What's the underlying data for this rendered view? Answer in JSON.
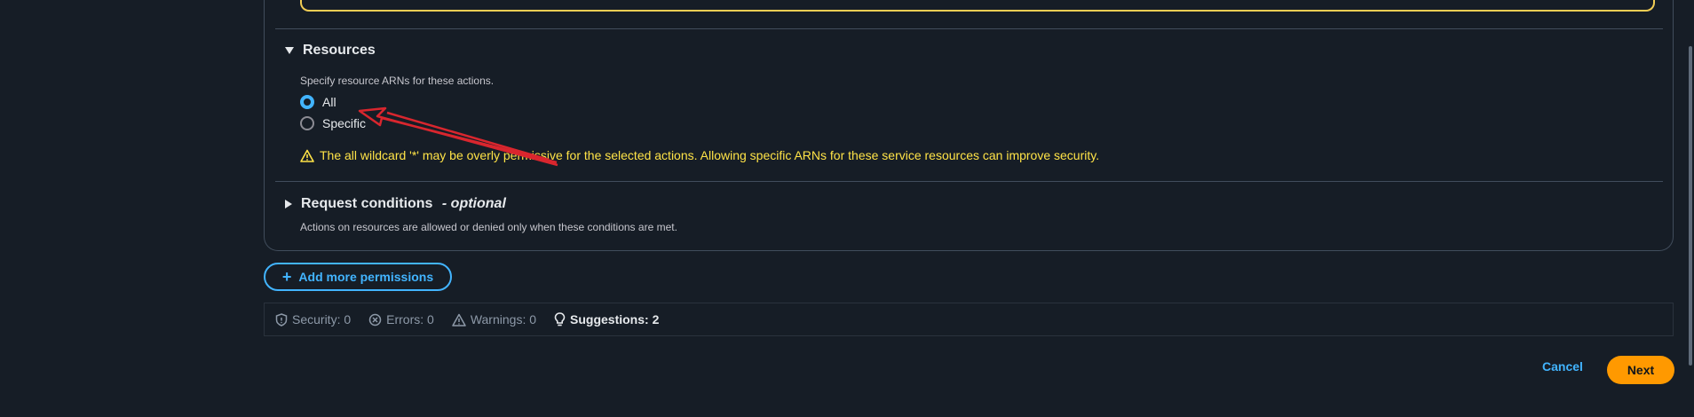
{
  "resources": {
    "title": "Resources",
    "description": "Specify resource ARNs for these actions.",
    "options": [
      {
        "label": "All",
        "selected": true
      },
      {
        "label": "Specific",
        "selected": false
      }
    ],
    "warning": "The all wildcard '*' may be overly permissive for the selected actions. Allowing specific ARNs for these service resources can improve security."
  },
  "request_conditions": {
    "title": "Request conditions",
    "optional": "- optional",
    "description": "Actions on resources are allowed or denied only when these conditions are met."
  },
  "add_more_label": "Add more permissions",
  "status": {
    "security": "Security: 0",
    "errors": "Errors: 0",
    "warnings": "Warnings: 0",
    "suggestions": "Suggestions: 2"
  },
  "footer": {
    "cancel": "Cancel",
    "next": "Next"
  },
  "colors": {
    "background": "#161d26",
    "accent": "#42b4ff",
    "warning": "#ffe347",
    "primary_button": "#ff9900",
    "annotation_arrow": "#d9262e"
  },
  "icons": {
    "resources_toggle": "caret-down-icon",
    "conditions_toggle": "caret-right-icon",
    "warning": "warning-triangle-icon",
    "add": "plus-icon",
    "security": "shield-icon",
    "errors": "error-circle-icon",
    "warnings": "warning-triangle-icon",
    "suggestions": "lightbulb-icon"
  }
}
